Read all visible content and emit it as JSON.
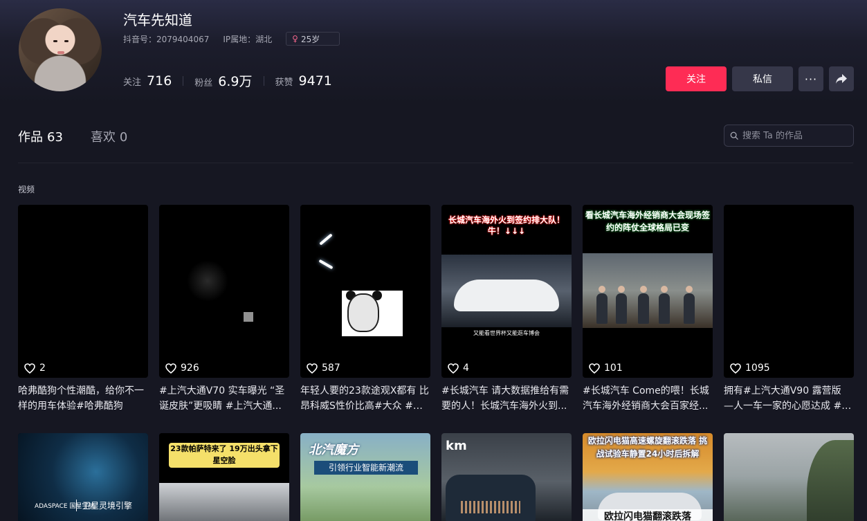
{
  "profile": {
    "name": "汽车先知道",
    "douyin_id": "抖音号：2079404067",
    "ip_location": "IP属地：湖北",
    "age_badge": "25岁",
    "stats": [
      {
        "label": "关注",
        "value": "716"
      },
      {
        "label": "粉丝",
        "value": "6.9万"
      },
      {
        "label": "获赞",
        "value": "9471"
      }
    ]
  },
  "actions": {
    "follow": "关注",
    "message": "私信",
    "more": "···"
  },
  "tabs": [
    {
      "label": "作品",
      "count": "63"
    },
    {
      "label": "喜欢",
      "count": "0"
    }
  ],
  "search": {
    "placeholder": "搜索 Ta 的作品"
  },
  "section_label": "视频",
  "videos": [
    {
      "likes": "2",
      "caption": "哈弗酷狗个性潮酷，给你不一样的用车体验#哈弗酷狗"
    },
    {
      "likes": "926",
      "caption": "#上汽大通V70 实车曝光 “圣诞皮肤”更吸睛 #上汽大通..."
    },
    {
      "likes": "587",
      "caption": "年轻人要的23款途观X都有 比昂科威S性价比高#大众 #上..."
    },
    {
      "likes": "4",
      "caption": "#长城汽车 请大数据推给有需要的人！长城汽车海外火到...",
      "overlay": "长城汽车海外火到签约排大队！牛！↓↓↓",
      "bottom_text": "又能看世界杯又能逛车博会"
    },
    {
      "likes": "101",
      "caption": "#长城汽车 Come的喂！长城汽车海外经销商大会百家经...",
      "overlay": "看长城汽车海外经销商大会现场签约的阵仗全球格局已变"
    },
    {
      "likes": "1095",
      "caption": "拥有#上汽大通V90 露营版 —人一车一家的心愿达成 #上..."
    }
  ],
  "videos_row2": [
    {
      "logo": "ADASPACE 国星宇航",
      "title": "卫星灵境引擎"
    },
    {
      "overlay": "23款帕萨特来了 19万出头拿下星空脸"
    },
    {
      "title": "北汽魔方",
      "subtitle": "引领行业智能新潮流"
    },
    {
      "overlay": "km"
    },
    {
      "overlay": "欧拉闪电猫高速螺旋翻滚跌落 挑战试验车静置24小时后拆解",
      "subtitle": "欧拉闪电猫翻滚跌落"
    },
    {}
  ],
  "colors": {
    "accent": "#fe2c55",
    "background": "#161722",
    "button_dark": "#363749"
  }
}
